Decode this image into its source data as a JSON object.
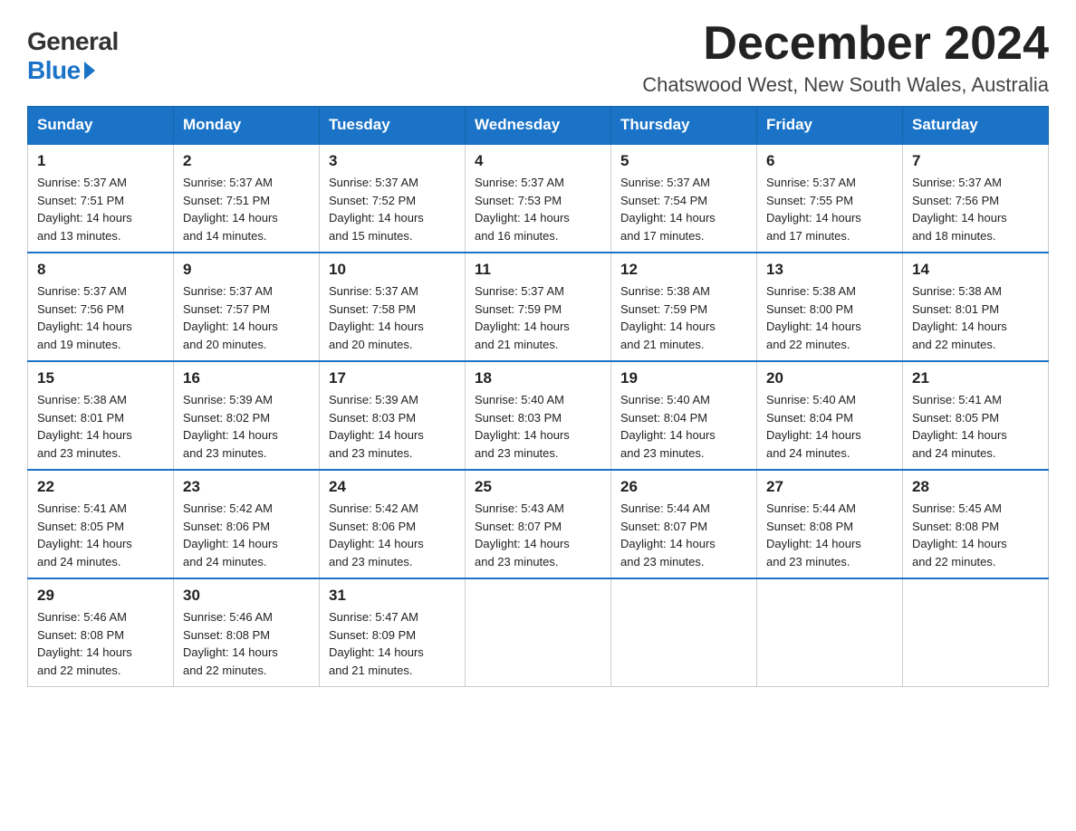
{
  "header": {
    "logo_general": "General",
    "logo_blue": "Blue",
    "month_year": "December 2024",
    "location": "Chatswood West, New South Wales, Australia"
  },
  "weekdays": [
    "Sunday",
    "Monday",
    "Tuesday",
    "Wednesday",
    "Thursday",
    "Friday",
    "Saturday"
  ],
  "weeks": [
    [
      {
        "day": "1",
        "sunrise": "5:37 AM",
        "sunset": "7:51 PM",
        "daylight": "14 hours and 13 minutes."
      },
      {
        "day": "2",
        "sunrise": "5:37 AM",
        "sunset": "7:51 PM",
        "daylight": "14 hours and 14 minutes."
      },
      {
        "day": "3",
        "sunrise": "5:37 AM",
        "sunset": "7:52 PM",
        "daylight": "14 hours and 15 minutes."
      },
      {
        "day": "4",
        "sunrise": "5:37 AM",
        "sunset": "7:53 PM",
        "daylight": "14 hours and 16 minutes."
      },
      {
        "day": "5",
        "sunrise": "5:37 AM",
        "sunset": "7:54 PM",
        "daylight": "14 hours and 17 minutes."
      },
      {
        "day": "6",
        "sunrise": "5:37 AM",
        "sunset": "7:55 PM",
        "daylight": "14 hours and 17 minutes."
      },
      {
        "day": "7",
        "sunrise": "5:37 AM",
        "sunset": "7:56 PM",
        "daylight": "14 hours and 18 minutes."
      }
    ],
    [
      {
        "day": "8",
        "sunrise": "5:37 AM",
        "sunset": "7:56 PM",
        "daylight": "14 hours and 19 minutes."
      },
      {
        "day": "9",
        "sunrise": "5:37 AM",
        "sunset": "7:57 PM",
        "daylight": "14 hours and 20 minutes."
      },
      {
        "day": "10",
        "sunrise": "5:37 AM",
        "sunset": "7:58 PM",
        "daylight": "14 hours and 20 minutes."
      },
      {
        "day": "11",
        "sunrise": "5:37 AM",
        "sunset": "7:59 PM",
        "daylight": "14 hours and 21 minutes."
      },
      {
        "day": "12",
        "sunrise": "5:38 AM",
        "sunset": "7:59 PM",
        "daylight": "14 hours and 21 minutes."
      },
      {
        "day": "13",
        "sunrise": "5:38 AM",
        "sunset": "8:00 PM",
        "daylight": "14 hours and 22 minutes."
      },
      {
        "day": "14",
        "sunrise": "5:38 AM",
        "sunset": "8:01 PM",
        "daylight": "14 hours and 22 minutes."
      }
    ],
    [
      {
        "day": "15",
        "sunrise": "5:38 AM",
        "sunset": "8:01 PM",
        "daylight": "14 hours and 23 minutes."
      },
      {
        "day": "16",
        "sunrise": "5:39 AM",
        "sunset": "8:02 PM",
        "daylight": "14 hours and 23 minutes."
      },
      {
        "day": "17",
        "sunrise": "5:39 AM",
        "sunset": "8:03 PM",
        "daylight": "14 hours and 23 minutes."
      },
      {
        "day": "18",
        "sunrise": "5:40 AM",
        "sunset": "8:03 PM",
        "daylight": "14 hours and 23 minutes."
      },
      {
        "day": "19",
        "sunrise": "5:40 AM",
        "sunset": "8:04 PM",
        "daylight": "14 hours and 23 minutes."
      },
      {
        "day": "20",
        "sunrise": "5:40 AM",
        "sunset": "8:04 PM",
        "daylight": "14 hours and 24 minutes."
      },
      {
        "day": "21",
        "sunrise": "5:41 AM",
        "sunset": "8:05 PM",
        "daylight": "14 hours and 24 minutes."
      }
    ],
    [
      {
        "day": "22",
        "sunrise": "5:41 AM",
        "sunset": "8:05 PM",
        "daylight": "14 hours and 24 minutes."
      },
      {
        "day": "23",
        "sunrise": "5:42 AM",
        "sunset": "8:06 PM",
        "daylight": "14 hours and 24 minutes."
      },
      {
        "day": "24",
        "sunrise": "5:42 AM",
        "sunset": "8:06 PM",
        "daylight": "14 hours and 23 minutes."
      },
      {
        "day": "25",
        "sunrise": "5:43 AM",
        "sunset": "8:07 PM",
        "daylight": "14 hours and 23 minutes."
      },
      {
        "day": "26",
        "sunrise": "5:44 AM",
        "sunset": "8:07 PM",
        "daylight": "14 hours and 23 minutes."
      },
      {
        "day": "27",
        "sunrise": "5:44 AM",
        "sunset": "8:08 PM",
        "daylight": "14 hours and 23 minutes."
      },
      {
        "day": "28",
        "sunrise": "5:45 AM",
        "sunset": "8:08 PM",
        "daylight": "14 hours and 22 minutes."
      }
    ],
    [
      {
        "day": "29",
        "sunrise": "5:46 AM",
        "sunset": "8:08 PM",
        "daylight": "14 hours and 22 minutes."
      },
      {
        "day": "30",
        "sunrise": "5:46 AM",
        "sunset": "8:08 PM",
        "daylight": "14 hours and 22 minutes."
      },
      {
        "day": "31",
        "sunrise": "5:47 AM",
        "sunset": "8:09 PM",
        "daylight": "14 hours and 21 minutes."
      },
      null,
      null,
      null,
      null
    ]
  ],
  "labels": {
    "sunrise": "Sunrise:",
    "sunset": "Sunset:",
    "daylight": "Daylight:"
  }
}
